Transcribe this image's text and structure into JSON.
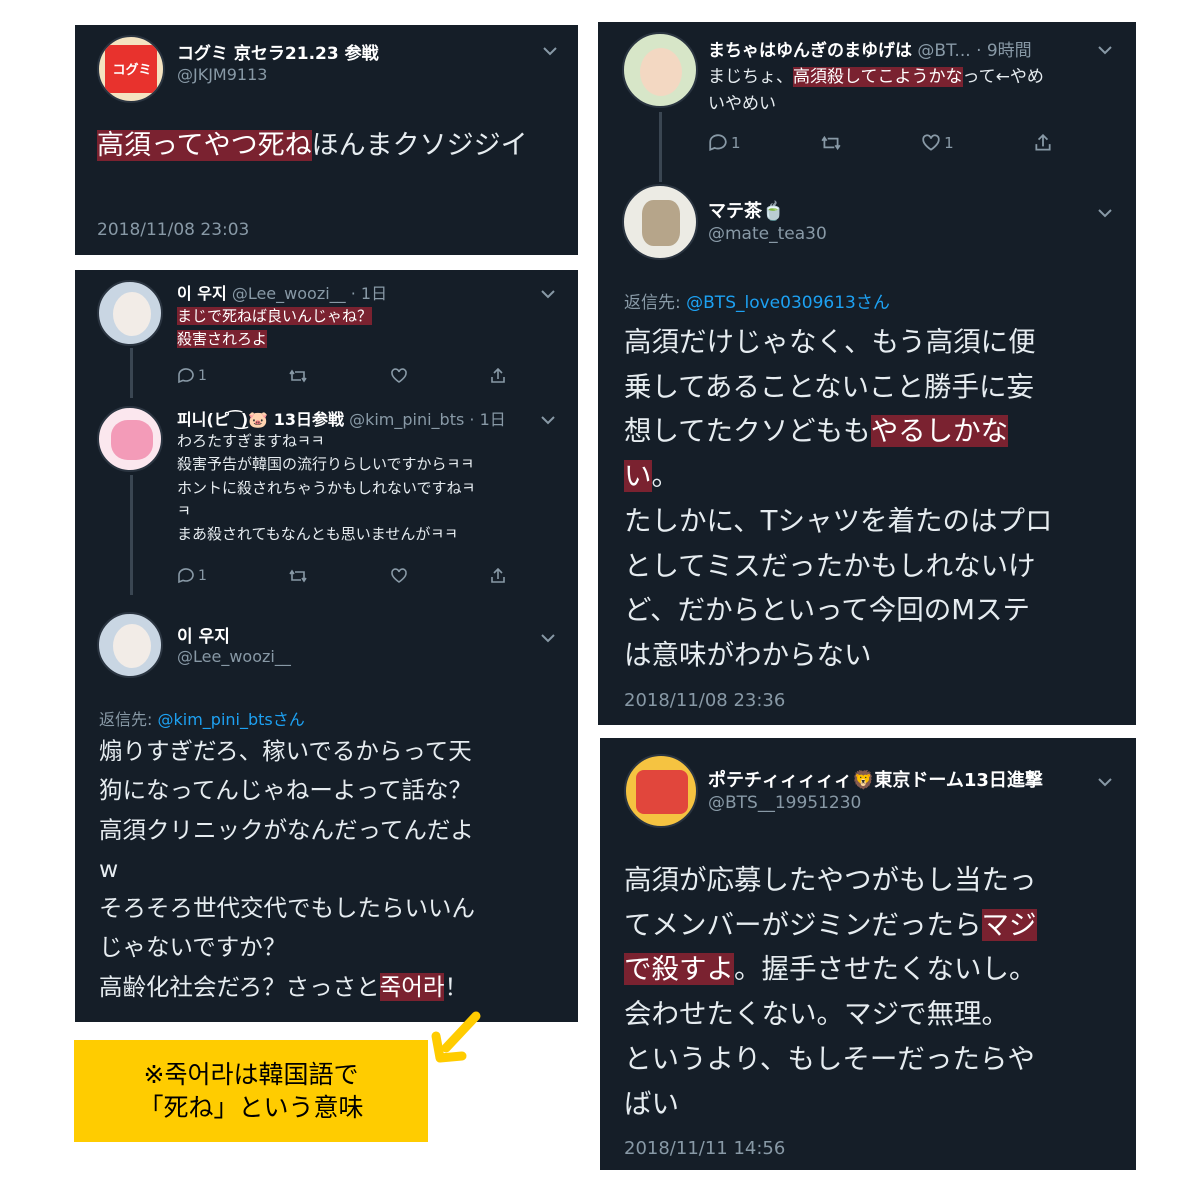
{
  "tweet1": {
    "name": "コグミ 京セラ21.23 参戦",
    "handle": "@JKJM9113",
    "avatar_text": "コグミ",
    "body_hl": "高須ってやつ死ね",
    "body_rest": "ほんまクソジジイ",
    "timestamp": "2018/11/08 23:03"
  },
  "tweet2": {
    "reply1": {
      "name": "이 우지",
      "handle": "@Lee_woozi__",
      "time": "· 1日",
      "line1": "まじで死ねば良いんじゃね？",
      "line2": "殺害されろよ",
      "reply_count": "1"
    },
    "reply2": {
      "name": "피니(ピ ͡ ͜)🐷 13日参戦",
      "handle": "@kim_pini_bts",
      "time": "· 1日",
      "lines": [
        "わろたすぎますねㅋㅋ",
        "殺害予告が韓国の流行りらしいですからㅋㅋ",
        "ホントに殺されちゃうかもしれないですねㅋ",
        "ㅋ",
        "まあ殺されてもなんとも思いませんがㅋㅋ"
      ],
      "reply_count": "1"
    },
    "main": {
      "name": "이 우지",
      "handle": "@Lee_woozi__",
      "reply_to_prefix": "返信先: ",
      "reply_to_user": "@kim_pini_btsさん",
      "lines": [
        "煽りすぎだろ、稼いでるからって天",
        "狗になってんじゃねーよって話な？",
        "高須クリニックがなんだってんだよ",
        "w",
        "そろそろ世代交代でもしたらいいん",
        "じゃないですか？"
      ],
      "last_line_pre": "高齢化社会だろ？さっさと",
      "last_line_hl": "죽어라",
      "last_line_post": "！"
    }
  },
  "note": {
    "line1": "※죽어라は韓国語で",
    "line2": "「死ね」という意味",
    "bg_color": "#ffcc00"
  },
  "tweet3": {
    "reply": {
      "name": "まちゃはゆんぎのまゆげは",
      "handle": "@BT...",
      "time": "· 9時間",
      "line1_pre": "まじちょ、",
      "line1_hl": "高須殺してこようかな",
      "line1_post": "って←やめ",
      "line2": "いやめい",
      "reply_count": "1",
      "like_count": "1"
    },
    "main": {
      "name": "マテ茶🍵",
      "handle": "@mate_tea30",
      "reply_to_prefix": "返信先: ",
      "reply_to_user": "@BTS_love0309613さん",
      "line1": "高須だけじゃなく、もう高須に便",
      "line2": "乗してあることないこと勝手に妄",
      "line3_pre": "想してたクソどもも",
      "line3_hl": "やるしかな",
      "line4_hl": "い",
      "line4_post": "。",
      "line5": "たしかに、Tシャツを着たのはプロ",
      "line6": "としてミスだったかもしれないけ",
      "line7": "ど、だからといって今回のMステ",
      "line8": "は意味がわからない",
      "timestamp": "2018/11/08 23:36"
    }
  },
  "tweet4": {
    "name": "ポテチィィィィィ🦁東京ドーム13日進撃",
    "handle": "@BTS__19951230",
    "line1": "高須が応募したやつがもし当たっ",
    "line2_pre": "てメンバーがジミンだったら",
    "line2_hl": "マジ",
    "line3_hl": "で殺すよ",
    "line3_post": "。握手させたくないし。",
    "line4": "会わせたくない。マジで無理。",
    "line5": "というより、もしそーだったらや",
    "line6": "ばい",
    "timestamp": "2018/11/11 14:56"
  },
  "colors": {
    "panel_bg": "#151e28",
    "highlight": "#7a2230",
    "link": "#1da1f2",
    "muted": "#8899a6",
    "arrow": "#ffcc00"
  }
}
